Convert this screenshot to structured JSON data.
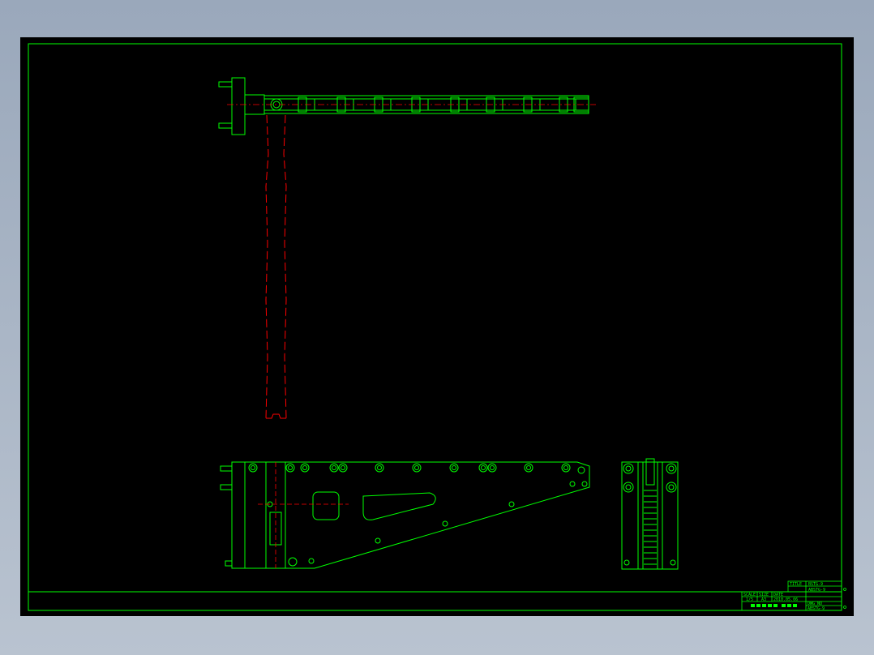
{
  "colors": {
    "app_background": "#a9b5c6",
    "sheet_background": "#000000",
    "drawing_line": "#00ff00",
    "hidden_line": "#ff0000",
    "title_block_text": "#00ff00"
  },
  "title_block": {
    "title_label": "TITLE",
    "title_value": "BSTG-9",
    "scale_label": "SCALE",
    "scale_value": "1/5",
    "size_label": "SIZE",
    "size_value": "A3",
    "date_label": "DATE",
    "date_value": "2010.05.06",
    "part_no_value": "ABSTG-9",
    "drawing_no_label": "DWG NO",
    "drawing_no_value": "ABSTG-9"
  }
}
